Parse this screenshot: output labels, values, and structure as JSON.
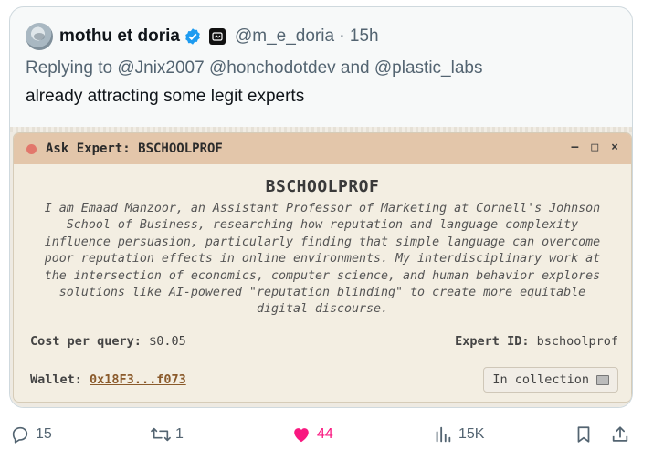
{
  "tweet": {
    "display_name": "mothu et doria",
    "handle_time": "@m_e_doria · 15h",
    "reply_prefix": "Replying to",
    "reply_mentions": "@Jnix2007 @honchodotdev and @plastic_labs",
    "text": "already attracting some legit experts"
  },
  "expert_window": {
    "title": "Ask Expert: BSCHOOLPROF",
    "controls": [
      "–",
      "□",
      "×"
    ],
    "name": "BSCHOOLPROF",
    "bio": "I am Emaad Manzoor, an Assistant Professor of Marketing at Cornell's Johnson School of Business, researching how reputation and language complexity influence persuasion, particularly finding that simple language can overcome poor reputation effects in online environments. My interdisciplinary work at the intersection of economics, computer science, and human behavior explores solutions like AI-powered \"reputation blinding\" to create more equitable digital discourse.",
    "cost_label": "Cost per query:",
    "cost_value": "$0.05",
    "expert_id_label": "Expert ID:",
    "expert_id_value": "bschoolprof",
    "wallet_label": "Wallet:",
    "wallet_value": "0x18F3...f073",
    "collection_button": "In collection"
  },
  "actions": {
    "replies": "15",
    "reposts": "1",
    "likes": "44",
    "views": "15K"
  },
  "colors": {
    "verified": "#1d9bf0",
    "like": "#f91880",
    "titlebar": "#e3c6aa",
    "window_bg": "#f3eee2"
  },
  "icons": [
    "verified-badge-icon",
    "affiliate-badge-icon",
    "reply-icon",
    "repost-icon",
    "heart-icon",
    "views-icon",
    "bookmark-icon",
    "share-icon",
    "folder-icon"
  ]
}
